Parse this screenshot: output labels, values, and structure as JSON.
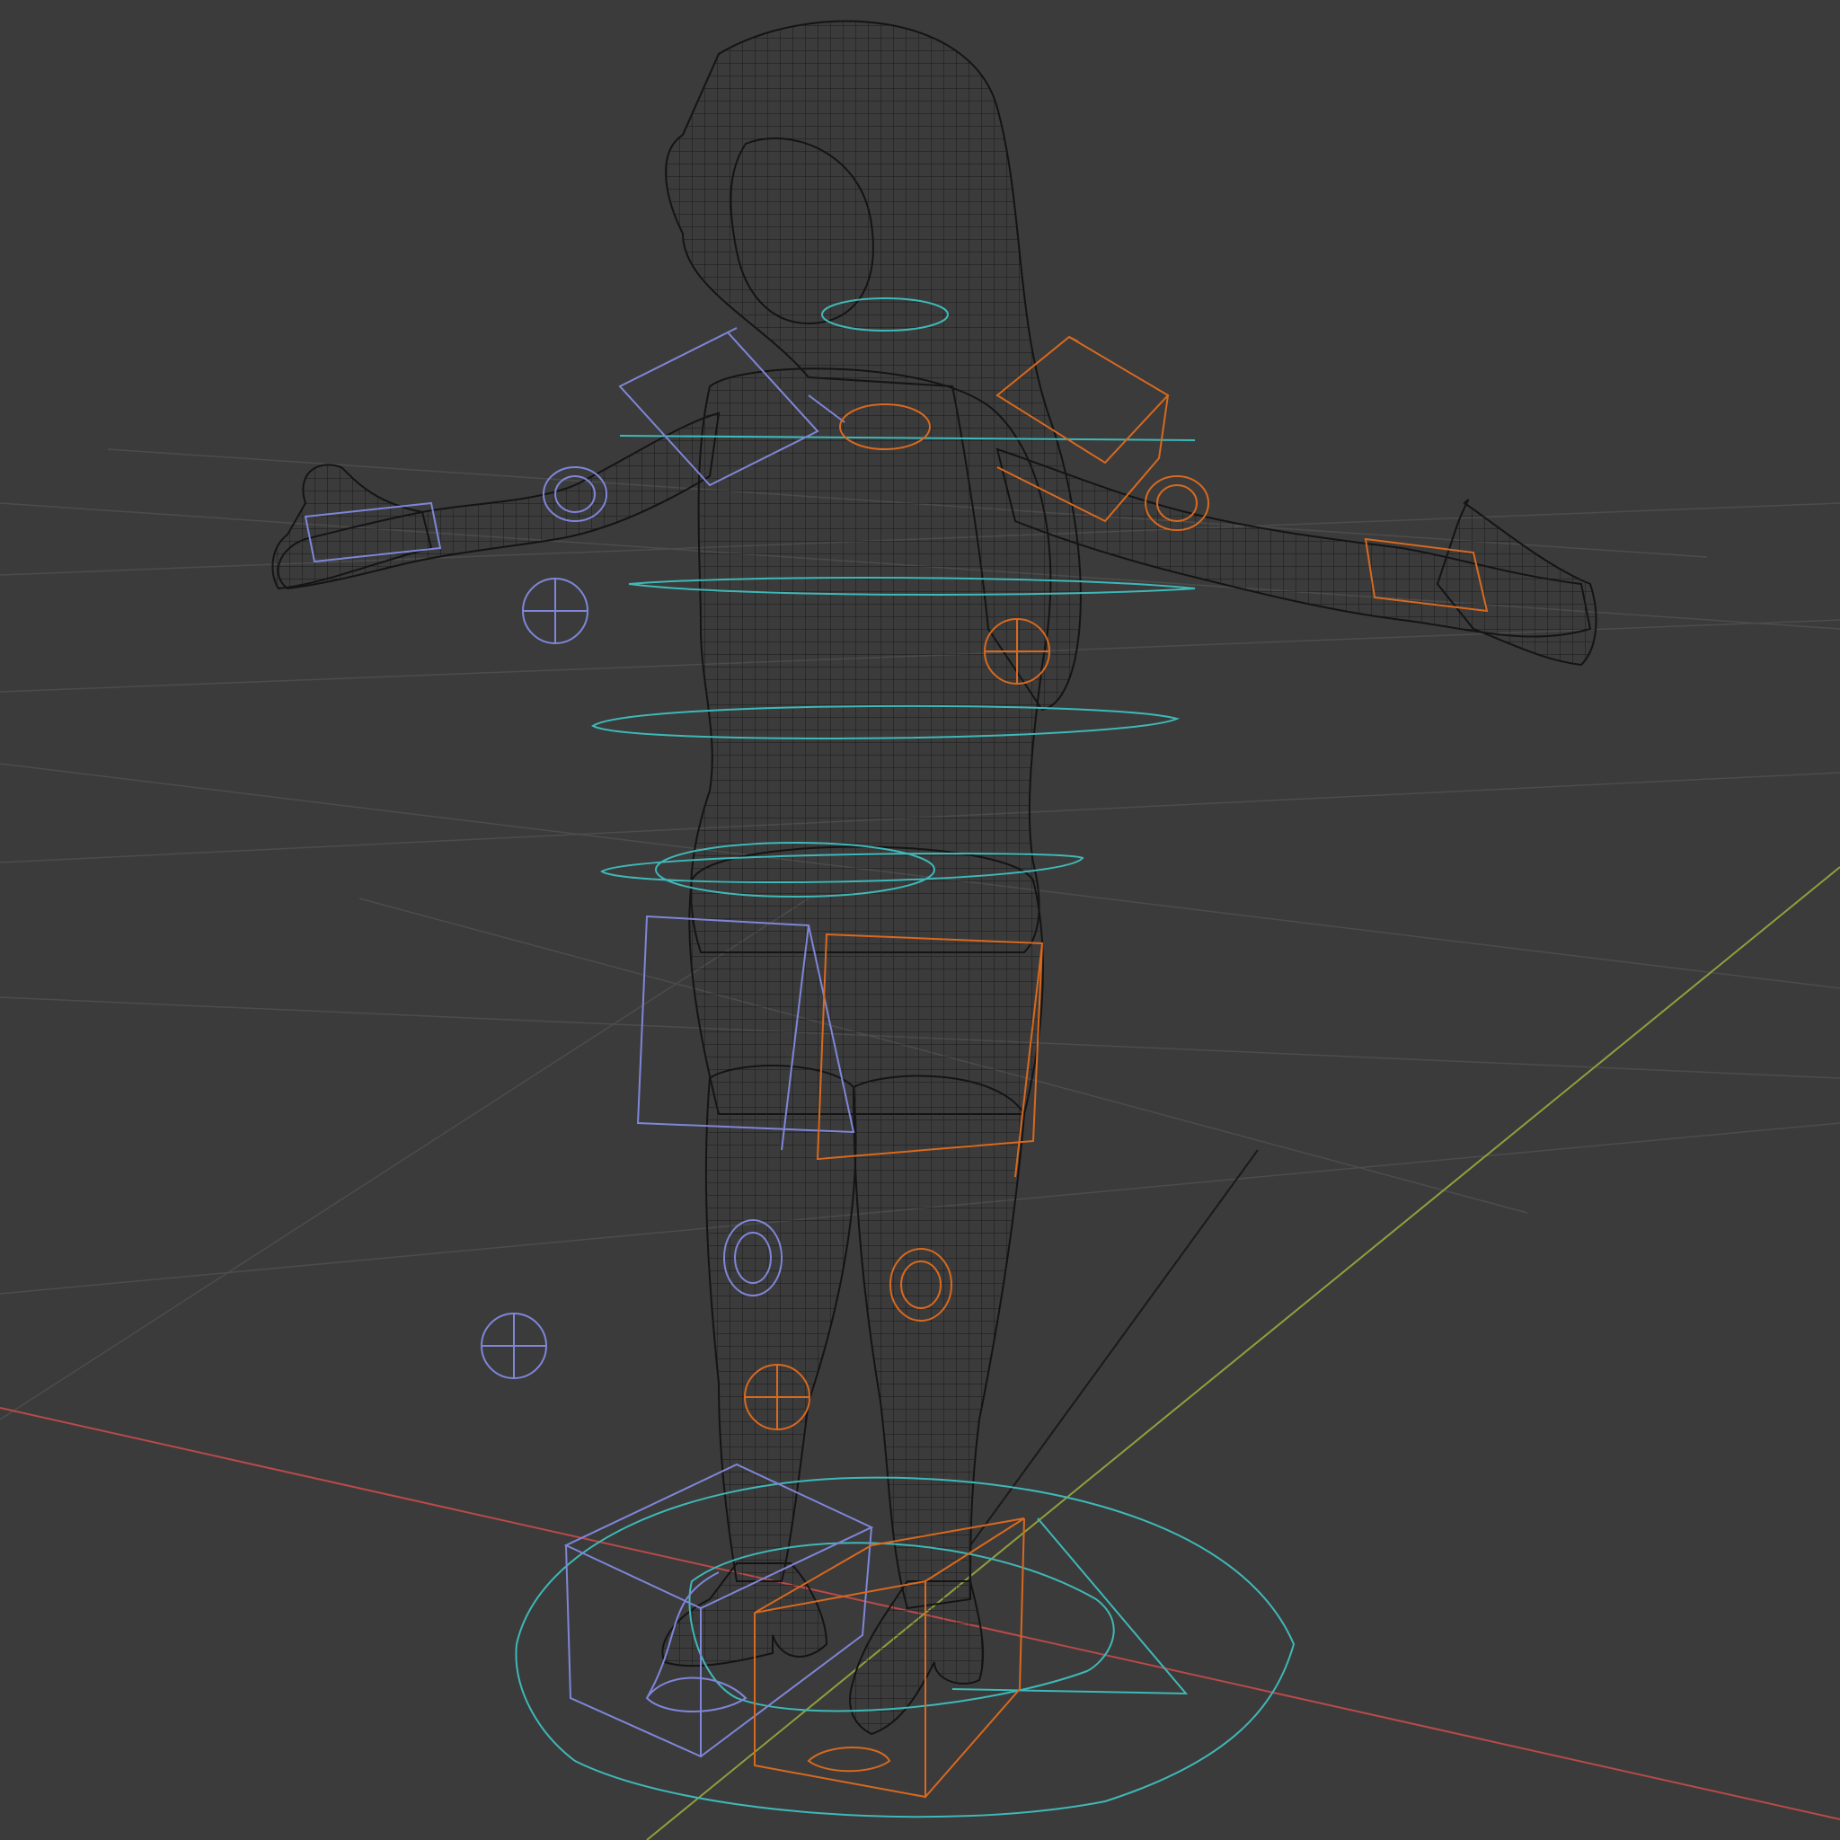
{
  "viewport": {
    "view": "3d-viewport",
    "shading": "wireframe",
    "subject": "character-mesh-with-rig-controls",
    "background_color": "#3b3b3b",
    "grid_color": "#4a4a4a",
    "mesh_wire_color": "#141414",
    "axis_x_color": "#b94a4a",
    "axis_y_color": "#8ea13a",
    "control_colors": {
      "center": "#3fb8b8",
      "left": "#7f86d8",
      "right": "#d8691f"
    }
  }
}
